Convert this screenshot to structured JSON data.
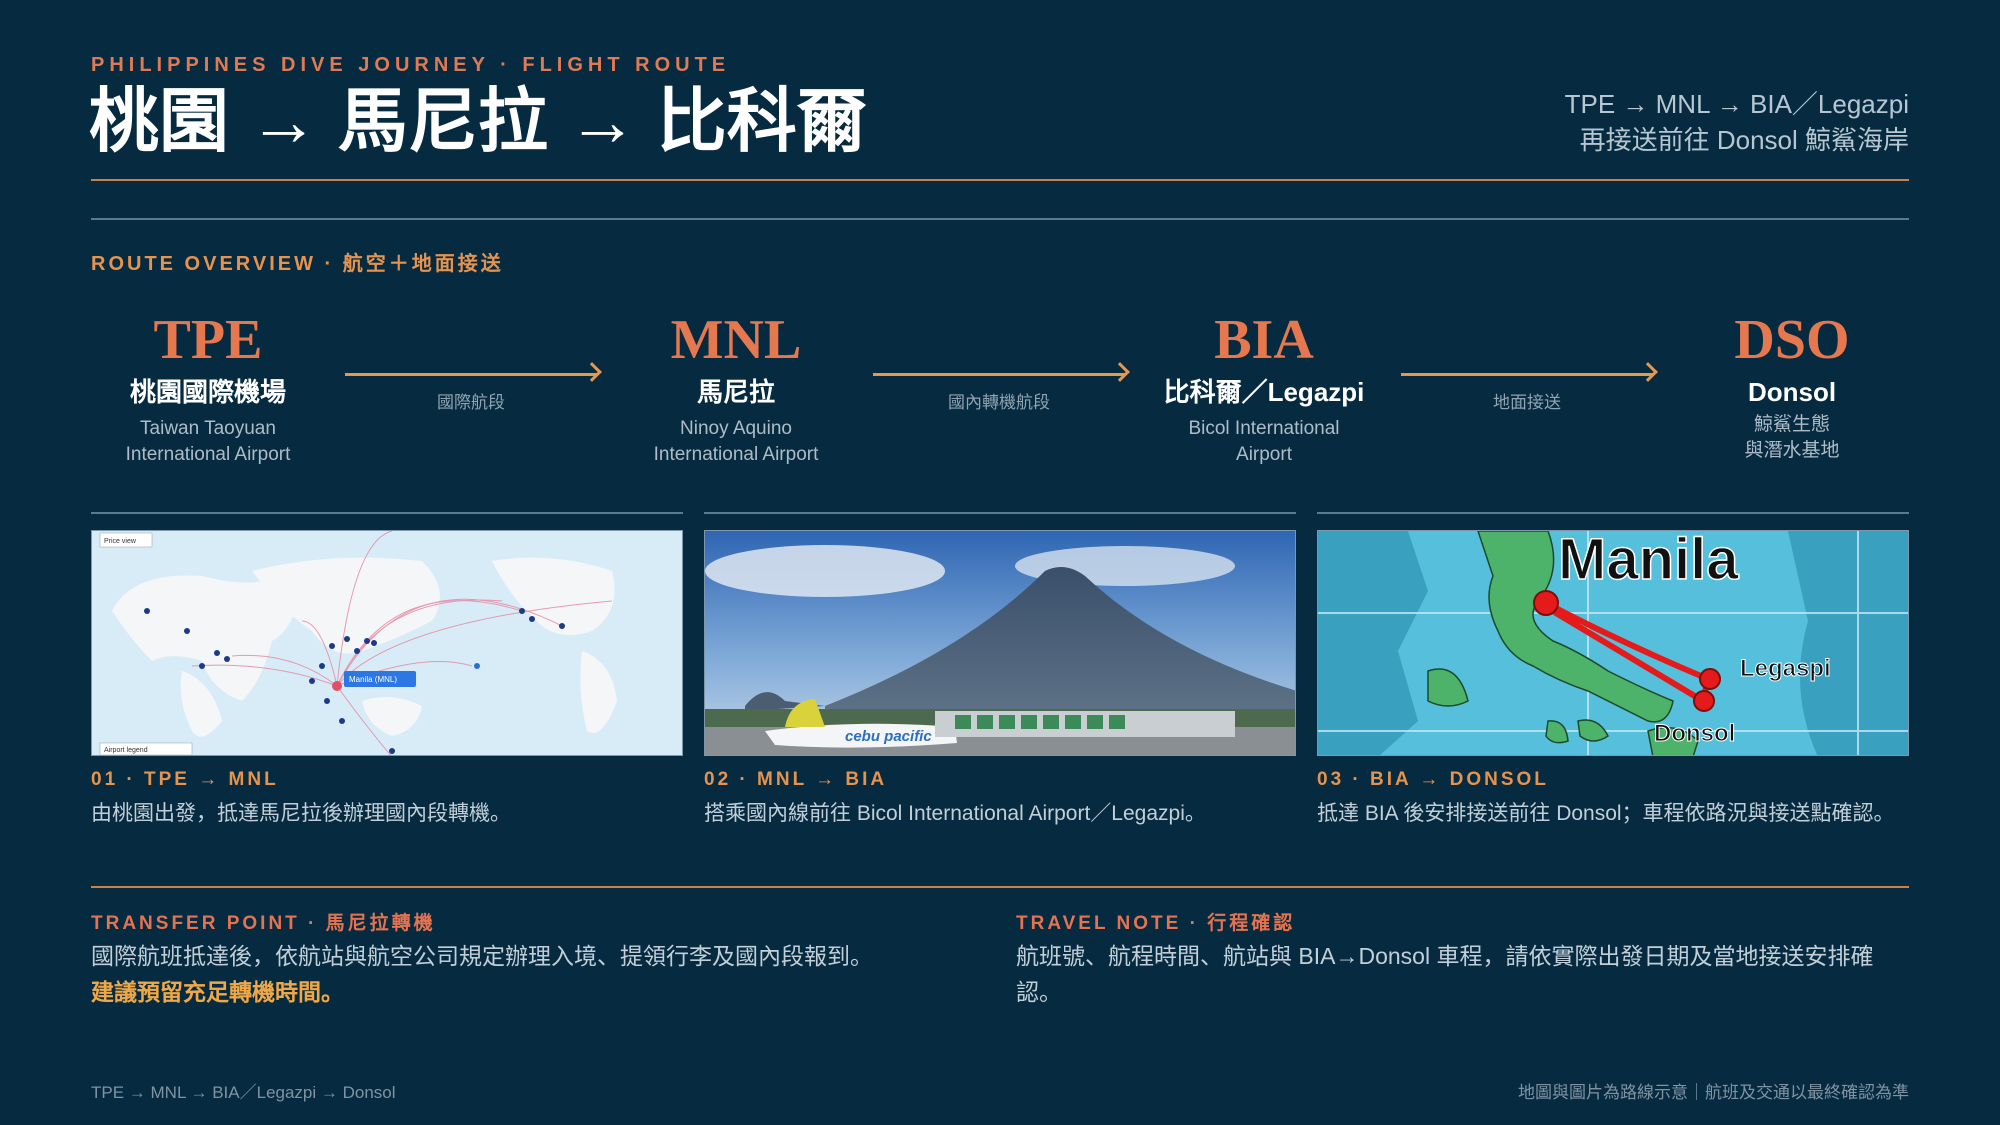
{
  "header": {
    "kicker": "PHILIPPINES DIVE JOURNEY · FLIGHT ROUTE",
    "title": "桃園 → 馬尼拉 → 比科爾",
    "route_line": "TPE → MNL → BIA／Legazpi",
    "route_sub": "再接送前往 Donsol 鯨鯊海岸"
  },
  "overview": {
    "label": "ROUTE OVERVIEW · 航空＋地面接送",
    "stops": [
      {
        "code": "TPE",
        "name": "桃園國際機場",
        "sub1": "Taiwan Taoyuan",
        "sub2": "International Airport"
      },
      {
        "code": "MNL",
        "name": "馬尼拉",
        "sub1": "Ninoy Aquino",
        "sub2": "International Airport"
      },
      {
        "code": "BIA",
        "name": "比科爾／Legazpi",
        "sub1": "Bicol International",
        "sub2": "Airport"
      },
      {
        "code": "DSO",
        "name": "Donsol",
        "sub1": "鯨鯊生態",
        "sub2": "與潛水基地"
      }
    ],
    "legs": [
      "國際航段",
      "國內轉機航段",
      "地面接送"
    ]
  },
  "steps": [
    {
      "title": "01 · TPE → MNL",
      "desc": "由桃園出發，抵達馬尼拉後辦理國內段轉機。",
      "map_badge": "Price view",
      "map_tag": "Manila (MNL)",
      "map_footer": "Airport legend"
    },
    {
      "title": "02 · MNL → BIA",
      "desc": "搭乘國內線前往 Bicol International Airport／Legazpi。",
      "plane_text": "cebu pacific"
    },
    {
      "title": "03 · BIA → DONSOL",
      "desc": "抵達 BIA 後安排接送前往 Donsol；車程依路況與接送點確認。",
      "map_manila": "Manila",
      "map_legaspi": "Legaspi",
      "map_donsol": "Donsol"
    }
  ],
  "notes": [
    {
      "title": "TRANSFER POINT · 馬尼拉轉機",
      "body": "國際航班抵達後，依航站與航空公司規定辦理入境、提領行李及國內段報到。",
      "highlight": "建議預留充足轉機時間。"
    },
    {
      "title": "TRAVEL NOTE · 行程確認",
      "body": "航班號、航程時間、航站與 BIA→Donsol 車程，請依實際出發日期及當地接送安排確認。"
    }
  ],
  "footer": {
    "left": "TPE → MNL → BIA／Legazpi → Donsol",
    "right": "地圖與圖片為路線示意｜航班及交通以最終確認為準"
  },
  "colors": {
    "background": "#062b40",
    "accent_orange": "#e6784f",
    "accent_amber": "#e5934e",
    "text_muted": "#c2cfd8"
  }
}
